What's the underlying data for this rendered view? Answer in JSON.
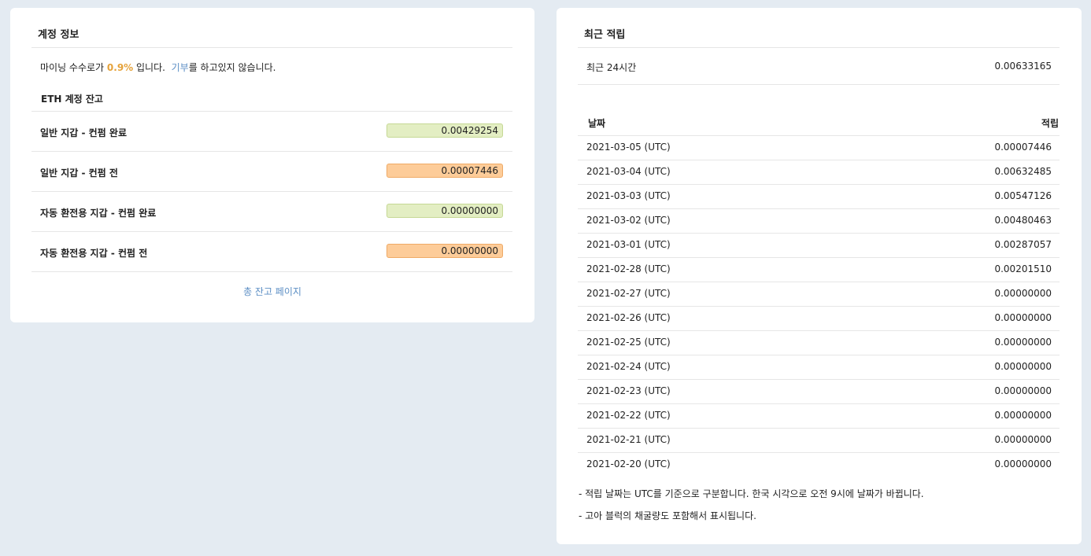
{
  "account": {
    "title": "계정 정보",
    "fee_prefix": "마이닝 수수로가 ",
    "fee_rate": "0.9%",
    "fee_mid": " 입니다.  ",
    "donation_link": "기부",
    "fee_suffix": "를 하고있지 않습니다.",
    "balance_heading": "ETH 계정 잔고",
    "balances": [
      {
        "label": "일반 지갑 - 컨펌 완료",
        "value": "0.00429254",
        "status": "confirmed"
      },
      {
        "label": "일반 지갑 - 컨펌 전",
        "value": "0.00007446",
        "status": "pending"
      },
      {
        "label": "자동 환전용 지갑 - 컨펌 완료",
        "value": "0.00000000",
        "status": "confirmed"
      },
      {
        "label": "자동 환전용 지갑 - 컨펌 전",
        "value": "0.00000000",
        "status": "pending"
      }
    ],
    "total_balance_link": "총 잔고 페이지",
    "colors": {
      "confirmed_bg": "#e3eec3",
      "pending_bg": "#fdcc99",
      "highlight": "#e5a23a",
      "link": "#5b8ec4"
    }
  },
  "earnings": {
    "title": "최근 적립",
    "last24_label": "최근 24시간",
    "last24_value": "0.00633165",
    "table": {
      "headers": {
        "date": "날짜",
        "amount": "적립"
      },
      "rows": [
        {
          "date": "2021-03-05 (UTC)",
          "amount": "0.00007446"
        },
        {
          "date": "2021-03-04 (UTC)",
          "amount": "0.00632485"
        },
        {
          "date": "2021-03-03 (UTC)",
          "amount": "0.00547126"
        },
        {
          "date": "2021-03-02 (UTC)",
          "amount": "0.00480463"
        },
        {
          "date": "2021-03-01 (UTC)",
          "amount": "0.00287057"
        },
        {
          "date": "2021-02-28 (UTC)",
          "amount": "0.00201510"
        },
        {
          "date": "2021-02-27 (UTC)",
          "amount": "0.00000000"
        },
        {
          "date": "2021-02-26 (UTC)",
          "amount": "0.00000000"
        },
        {
          "date": "2021-02-25 (UTC)",
          "amount": "0.00000000"
        },
        {
          "date": "2021-02-24 (UTC)",
          "amount": "0.00000000"
        },
        {
          "date": "2021-02-23 (UTC)",
          "amount": "0.00000000"
        },
        {
          "date": "2021-02-22 (UTC)",
          "amount": "0.00000000"
        },
        {
          "date": "2021-02-21 (UTC)",
          "amount": "0.00000000"
        },
        {
          "date": "2021-02-20 (UTC)",
          "amount": "0.00000000"
        }
      ]
    },
    "notes": [
      "- 적립 날짜는 UTC를 기준으로 구분합니다. 한국 시각으로 오전 9시에 날짜가 바뀝니다.",
      "- 고아 블럭의 채굴량도 포함해서 표시됩니다."
    ]
  }
}
